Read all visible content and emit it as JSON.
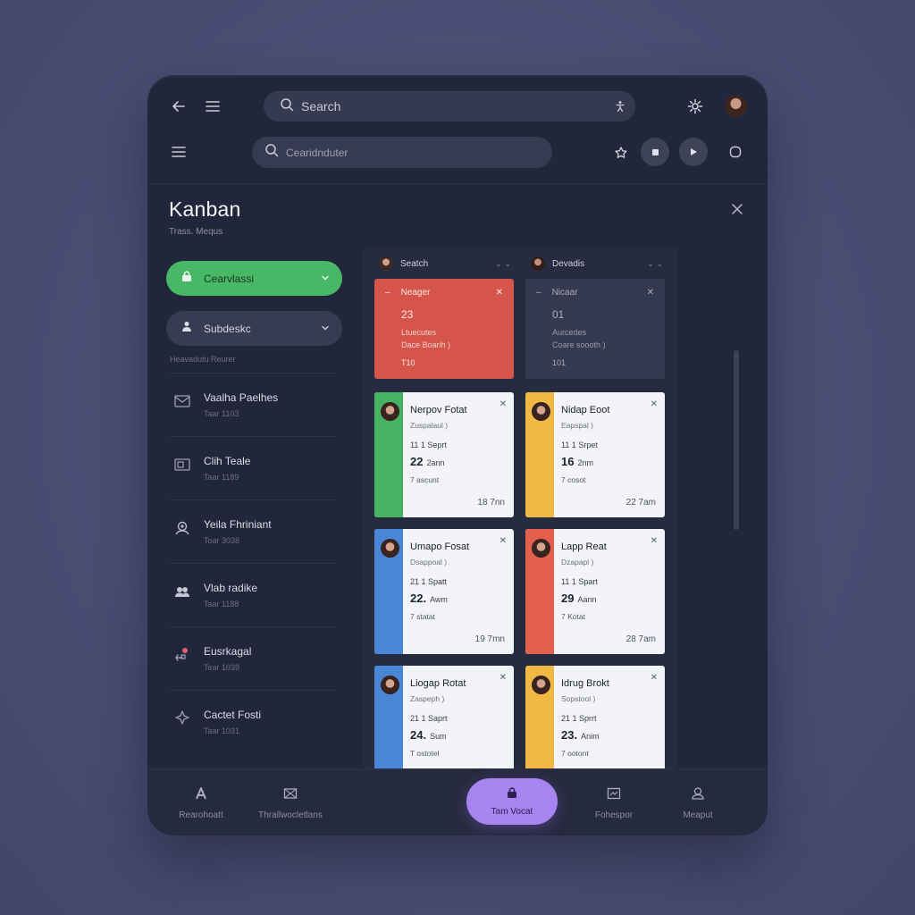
{
  "topbar": {
    "search_label": "Search"
  },
  "secondbar": {
    "search_placeholder": "Cearidnduter"
  },
  "header": {
    "title": "Kanban",
    "subtitle": "Trass. Mequs"
  },
  "sidebar": {
    "primary_pill": "Cearvlassi",
    "secondary_pill": "Subdeskc",
    "caption": "Heavadutu Reurer",
    "items": [
      {
        "label": "Vaalha Paelhes",
        "sub": "Taar  1103"
      },
      {
        "label": "Clih Teale",
        "sub": "Taar  1189"
      },
      {
        "label": "Yeila Fhriniant",
        "sub": "Toar  3038"
      },
      {
        "label": "Vlab radike",
        "sub": "Taar  1188"
      },
      {
        "label": "Eusrkagal",
        "sub": "Tear  1039"
      },
      {
        "label": "Cactet Fosti",
        "sub": "Taar  1031"
      }
    ]
  },
  "board": {
    "columns": [
      {
        "name": "Seatch",
        "top_card": {
          "title": "Neager",
          "num": "23",
          "line1": "Ltuecutes",
          "line2": "Dace Boarih )",
          "footer": "T10"
        },
        "cards": [
          {
            "title": "Nerpov Fotat",
            "sub": "Zuspalaul )",
            "r3": "11   1 Seprt",
            "r4_big": "22",
            "r4": "2ann",
            "r5": "7 ascunt",
            "time": "18  7nn",
            "color": "#45b362"
          },
          {
            "title": "Umapo Fosat",
            "sub": "Dsappoal )",
            "r3": "21   1 Spatt",
            "r4_big": "22.",
            "r4": "Awm",
            "r5": "7 statat",
            "time": "19 7mn",
            "color": "#4a86d6"
          },
          {
            "title": "Liogap Rotat",
            "sub": "Zaspeph )",
            "r3": "21   1 Saprt",
            "r4_big": "24.",
            "r4": "Sum",
            "r5": "T ostotel",
            "time": "",
            "color": "#4a86d6"
          }
        ]
      },
      {
        "name": "Devadis",
        "top_card": {
          "title": "Nicaar",
          "num": "01",
          "line1": "Aurcedes",
          "line2": "Coare soooth )",
          "footer": "101"
        },
        "cards": [
          {
            "title": "Nidap Eoot",
            "sub": "Eapspal )",
            "r3": "11   1 Srpet",
            "r4_big": "16",
            "r4": "2nm",
            "r5": "7 cosot",
            "time": "22 7am",
            "color": "#f1b844"
          },
          {
            "title": "Lapp Reat",
            "sub": "Dzapapl )",
            "r3": "11   1 Spart",
            "r4_big": "29",
            "r4": "Aann",
            "r5": "7 Kotat",
            "time": "28 7am",
            "color": "#e4614e"
          },
          {
            "title": "Idrug Brokt",
            "sub": "Sopstool )",
            "r3": "21   1 Sprrt",
            "r4_big": "23.",
            "r4": "Anim",
            "r5": "7 ootont",
            "time": "",
            "color": "#f1b844"
          }
        ]
      }
    ]
  },
  "bottom_nav": {
    "items": [
      "Rearohoatt",
      "Thrallwocletlans",
      "Tam Vocat",
      "Fohespor",
      "Meaput"
    ]
  },
  "colors": {
    "background": "#4b4e74",
    "panel": "#22263a",
    "green": "#48b766",
    "red": "#d5554b",
    "blue": "#4a86d6",
    "yellow": "#f1b844",
    "purple": "#a884f0"
  }
}
